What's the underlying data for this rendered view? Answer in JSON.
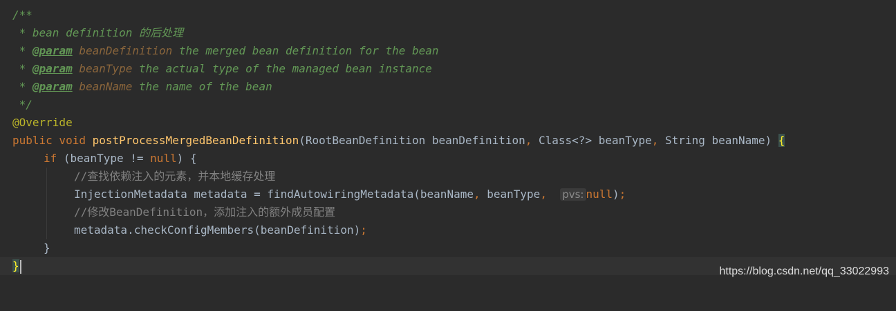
{
  "doc": {
    "open": "/**",
    "desc_prefix": " * ",
    "desc": "bean definition 的后处理",
    "params": [
      {
        "tag": "@param",
        "name": "beanDefinition",
        "text": "the merged bean definition for the bean"
      },
      {
        "tag": "@param",
        "name": "beanType",
        "text": "the actual type of the managed bean instance"
      },
      {
        "tag": "@param",
        "name": "beanName",
        "text": "the name of the bean"
      }
    ],
    "close": " */"
  },
  "annotation": "@Override",
  "signature": {
    "mods": "public void ",
    "method": "postProcessMergedBeanDefinition",
    "params": "(RootBeanDefinition beanDefinition",
    "comma1": ",",
    "p2": " Class<?> beanType",
    "comma2": ",",
    "p3": " String beanName) ",
    "brace": "{"
  },
  "body": {
    "if_kw": "if",
    "if_cond": " (beanType != ",
    "null_kw": "null",
    "if_close": ") {",
    "comment1": "//查找依赖注入的元素，并本地缓存处理",
    "stmt1_a": "InjectionMetadata metadata = findAutowiringMetadata(beanName",
    "stmt1_comma1": ",",
    "stmt1_b": " beanType",
    "stmt1_comma2": ",",
    "hint": "pvs:",
    "stmt1_null": "null",
    "stmt1_end": ")",
    "semi": ";",
    "comment2": "//修改BeanDefinition，添加注入的额外成员配置",
    "stmt2": "metadata.checkConfigMembers(beanDefinition)",
    "semi2": ";",
    "inner_close": "}",
    "outer_close": "}"
  },
  "watermark": "https://blog.csdn.net/qq_33022993"
}
